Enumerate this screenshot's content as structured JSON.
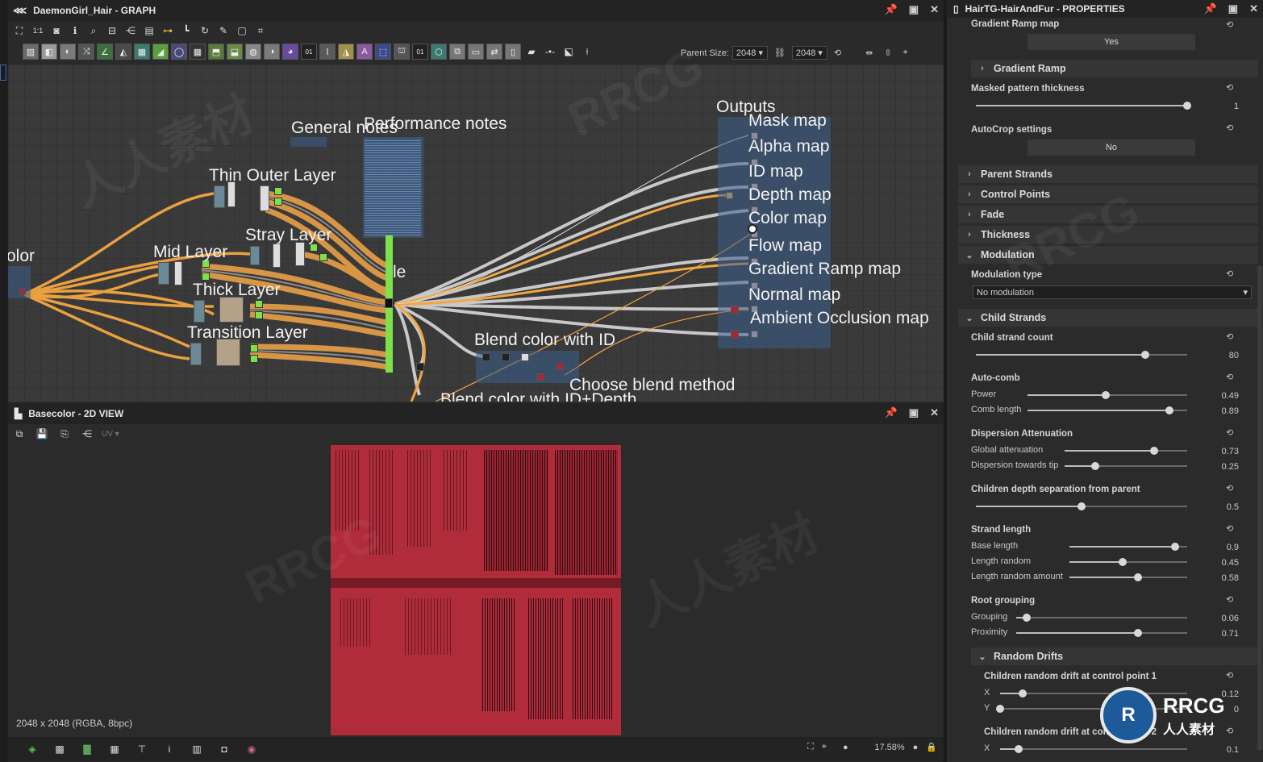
{
  "graph_panel": {
    "title": "DaemonGirl_Hair - GRAPH",
    "parent_size_label": "Parent Size:",
    "parent_size_value": "2048",
    "size_value": "2048",
    "labels": {
      "color": "olor",
      "mid_layer": "Mid Layer",
      "thin_outer_layer": "Thin Outer Layer",
      "stray_layer": "Stray Layer",
      "thick_layer": "Thick Layer",
      "transition_layer": "Transition Layer",
      "general_notes": "General notes",
      "performance_notes": "Performance notes",
      "blend_color_id": "Blend color with ID",
      "choose_blend": "Choose blend method",
      "blend_color_depth": "Blend color with ID+Depth",
      "le": "le",
      "outputs": "Outputs"
    },
    "outputs": [
      "Mask map",
      "Alpha map",
      "ID map",
      "Depth map",
      "Color map",
      "Flow map",
      "Gradient Ramp map",
      "Normal map",
      "Ambient Occlusion map"
    ]
  },
  "view_panel": {
    "title": "Basecolor - 2D VIEW",
    "uv_label": "UV",
    "info": "2048 x 2048 (RGBA, 8bpc)",
    "zoom": "17.58%"
  },
  "properties_panel": {
    "title": "HairTG-HairAndFur - PROPERTIES",
    "gradient_ramp_map_label": "Gradient Ramp  map",
    "gradient_ramp_map_value": "Yes",
    "gradient_ramp_section": "Gradient Ramp",
    "masked_pattern": {
      "label": "Masked pattern thickness",
      "value": "1",
      "fraction": 1.0
    },
    "autocrop": {
      "label": "AutoCrop settings",
      "value": "No"
    },
    "sections": [
      "Parent Strands",
      "Control Points",
      "Fade",
      "Thickness",
      "Modulation"
    ],
    "modulation_type": {
      "label": "Modulation type",
      "value": "No modulation"
    },
    "child_strands": "Child Strands",
    "child_strand_count": {
      "label": "Child strand count",
      "value": "80",
      "fraction": 0.8
    },
    "auto_comb": {
      "label": "Auto-comb",
      "power": {
        "label": "Power",
        "value": "0.49",
        "fraction": 0.49
      },
      "comb_length": {
        "label": "Comb length",
        "value": "0.89",
        "fraction": 0.89
      }
    },
    "dispersion": {
      "label": "Dispersion Attenuation",
      "global": {
        "label": "Global attenuation",
        "value": "0.73",
        "fraction": 0.73
      },
      "towards_tip": {
        "label": "Dispersion towards tip",
        "value": "0.25",
        "fraction": 0.25
      }
    },
    "children_depth": {
      "label": "Children depth separation from parent",
      "value": "0.5",
      "fraction": 0.5
    },
    "strand_length": {
      "label": "Strand length",
      "base": {
        "label": "Base length",
        "value": "0.9",
        "fraction": 0.9
      },
      "random": {
        "label": "Length random",
        "value": "0.45",
        "fraction": 0.45
      },
      "random_amount": {
        "label": "Length random amount",
        "value": "0.58",
        "fraction": 0.58
      }
    },
    "root_grouping": {
      "label": "Root grouping",
      "grouping": {
        "label": "Grouping",
        "value": "0.06",
        "fraction": 0.06
      },
      "proximity": {
        "label": "Proximity",
        "value": "0.71",
        "fraction": 0.71
      }
    },
    "random_drifts": "Random Drifts",
    "drift1": {
      "label": "Children random drift at control point 1",
      "x": {
        "label": "X",
        "value": "0.12",
        "fraction": 0.12
      },
      "y": {
        "label": "Y",
        "value": "0",
        "fraction": 0.0
      }
    },
    "drift2": {
      "label": "Children random drift at control point 2",
      "x": {
        "label": "X",
        "value": "0.1",
        "fraction": 0.1
      }
    }
  },
  "watermark": {
    "brand": "RRCG",
    "cn": "人人素材"
  },
  "colors": {
    "accent_orange": "#f4a640",
    "node_green": "#7ee04a",
    "frame_blue": "#3c5f8c",
    "texture_red": "#b02c3a"
  }
}
